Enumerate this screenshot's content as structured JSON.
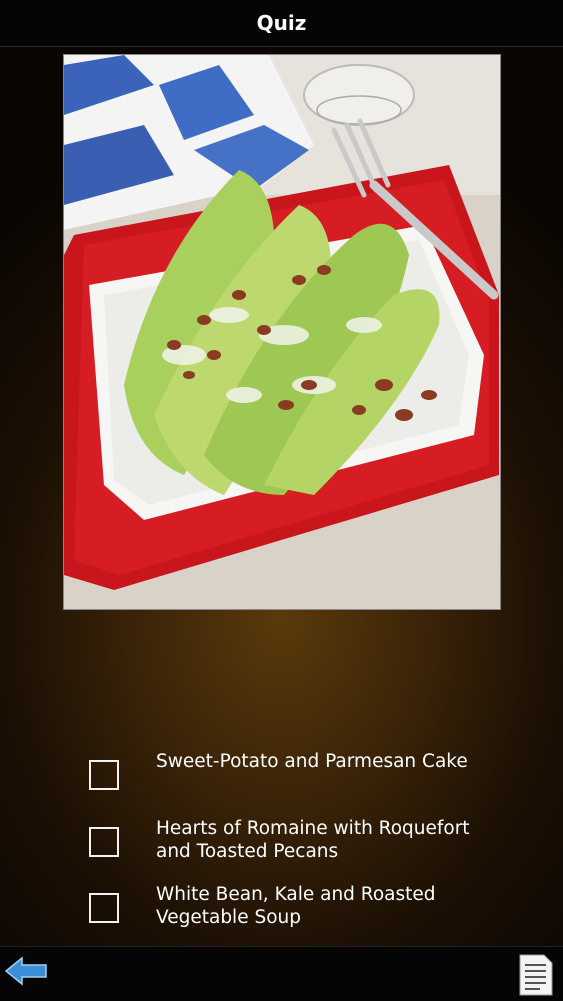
{
  "header": {
    "title": "Quiz"
  },
  "image": {
    "alt": "Salad photo",
    "icon": "salad-photo"
  },
  "quiz": {
    "options": [
      {
        "label": "Sweet-Potato and Parmesan Cake",
        "checked": false
      },
      {
        "label": "Hearts of Romaine with Roquefort and Toasted Pecans",
        "checked": false
      },
      {
        "label": "White Bean, Kale and Roasted Vegetable Soup",
        "checked": false
      }
    ]
  },
  "bottom_bar": {
    "back_icon": "back-arrow-icon",
    "notes_icon": "notes-icon"
  },
  "colors": {
    "accent_blue": "#3a8fd6",
    "background": "#3a2308"
  }
}
